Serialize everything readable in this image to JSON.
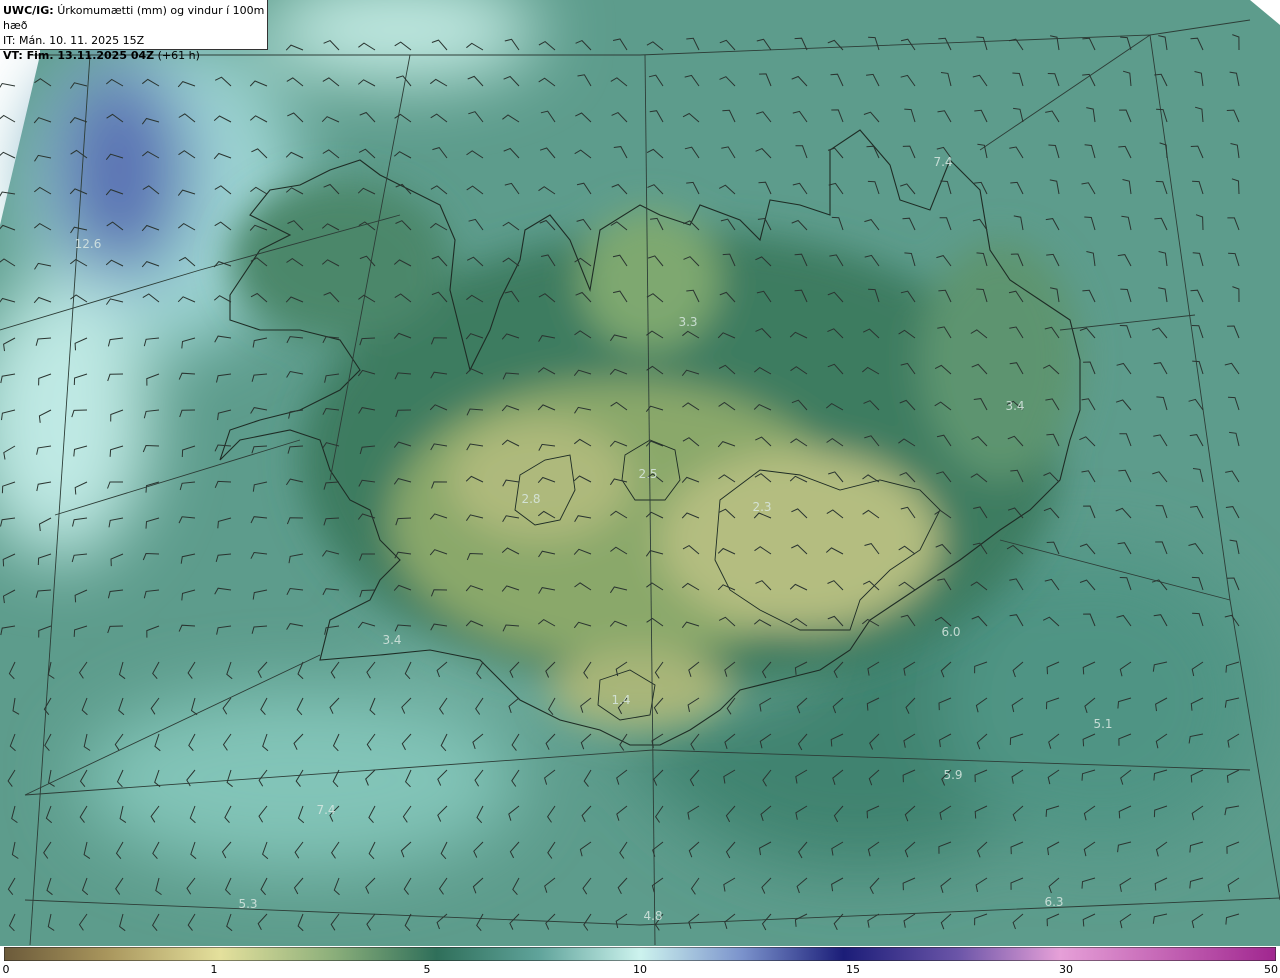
{
  "header": {
    "model": "UWC/IG:",
    "title": "Úrkomumætti (mm) og vindur í 100m hæð",
    "it": "IT: Mán. 10. 11. 2025 15Z",
    "vt": "VT: Fim. 13.11.2025 04Z",
    "vt_offset": "(+61 h)"
  },
  "map_values": [
    {
      "id": "v1",
      "text": "12.6"
    },
    {
      "id": "v2",
      "text": "3.3"
    },
    {
      "id": "v3",
      "text": "7.4"
    },
    {
      "id": "v4",
      "text": "3.4"
    },
    {
      "id": "v5",
      "text": "2.5"
    },
    {
      "id": "v6",
      "text": "2.8"
    },
    {
      "id": "v7",
      "text": "2.3"
    },
    {
      "id": "v8",
      "text": "3.4"
    },
    {
      "id": "v9",
      "text": "6.0"
    },
    {
      "id": "v10",
      "text": "1.4"
    },
    {
      "id": "v11",
      "text": "5.1"
    },
    {
      "id": "v12",
      "text": "5.9"
    },
    {
      "id": "v13",
      "text": "7.4"
    },
    {
      "id": "v14",
      "text": "5.3"
    },
    {
      "id": "v15",
      "text": "4.8"
    },
    {
      "id": "v16",
      "text": "6.3"
    }
  ],
  "colorbar": {
    "ticks": [
      "0",
      "1",
      "5",
      "10",
      "15",
      "30",
      "50"
    ],
    "colors": [
      "#6b5a3a",
      "#c9b774",
      "#e7e59a",
      "#2f6f5a",
      "#5fa39a",
      "#cdf3ee",
      "#3a4aa0",
      "#1b1d78",
      "#e6a0d8",
      "#a0268f"
    ]
  }
}
